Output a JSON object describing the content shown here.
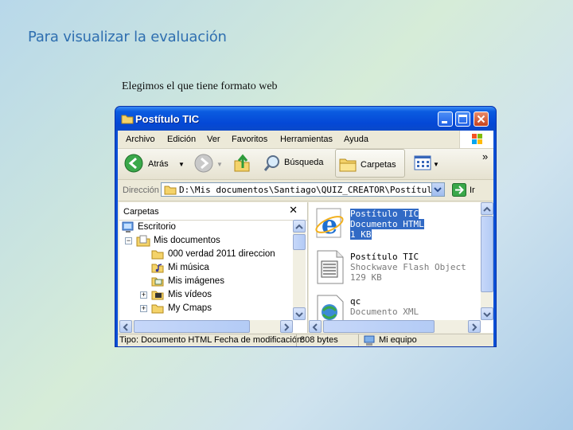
{
  "slide": {
    "title": "Para visualizar la evaluación",
    "subtitle": "Elegimos el que tiene formato web"
  },
  "window": {
    "title": "Postítulo TIC",
    "menu": [
      "Archivo",
      "Edición",
      "Ver",
      "Favoritos",
      "Herramientas",
      "Ayuda"
    ],
    "toolbar": {
      "back": "Atrás",
      "search": "Búsqueda",
      "folders": "Carpetas",
      "more": "»"
    },
    "address": {
      "label": "Dirección",
      "value": "D:\\Mis documentos\\Santiago\\QUIZ_CREATOR\\Postítulo",
      "go": "Ir"
    },
    "folders_pane": {
      "header": "Carpetas",
      "close": "✕",
      "items": [
        "Escritorio",
        "Mis documentos",
        "000 verdad 2011 direccion",
        "Mi música",
        "Mis imágenes",
        "Mis vídeos",
        "My Cmaps"
      ]
    },
    "files": [
      {
        "name": "Postítulo TIC",
        "type": "Documento HTML",
        "size": "1 KB",
        "icon": "ie-html-icon"
      },
      {
        "name": "Postítulo TIC",
        "type": "Shockwave Flash Object",
        "size": "129 KB",
        "icon": "swf-file-icon"
      },
      {
        "name": "qc",
        "type": "Documento XML",
        "icon": "xml-file-icon"
      }
    ],
    "status": {
      "left": "Tipo: Documento HTML Fecha de modificación:",
      "size": "808 bytes",
      "location": "Mi equipo"
    }
  }
}
